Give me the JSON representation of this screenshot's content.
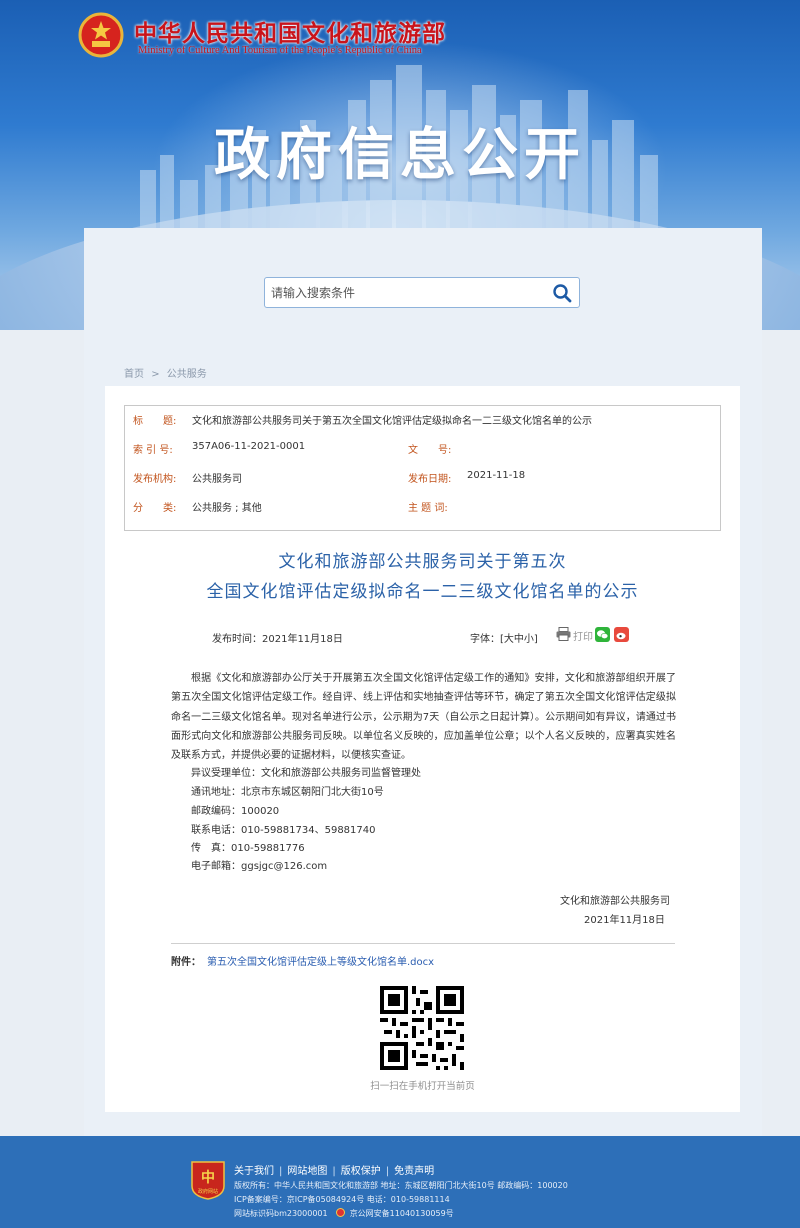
{
  "header": {
    "logo_cn": "中华人民共和国文化和旅游部",
    "logo_en": "Ministry of Culture And Tourism of the People’s Republic of China",
    "banner_title": "政府信息公开"
  },
  "search": {
    "placeholder": "请输入搜索条件"
  },
  "breadcrumb": {
    "home": "首页",
    "separator": ">",
    "section": "公共服务"
  },
  "meta": {
    "title_label": "标　　题:",
    "title_value": "文化和旅游部公共服务司关于第五次全国文化馆评估定级拟命名一二三级文化馆名单的公示",
    "index_label": "索 引 号:",
    "index_value": "357A06-11-2021-0001",
    "docno_label": "文　　号:",
    "docno_value": "",
    "publisher_label": "发布机构:",
    "publisher_value": "公共服务司",
    "date_label": "发布日期:",
    "date_value": "2021-11-18",
    "category_label": "分　　类:",
    "category_value": "公共服务 ;  其他",
    "subject_label": "主 题 词:",
    "subject_value": ""
  },
  "document": {
    "title_line1": "文化和旅游部公共服务司关于第五次",
    "title_line2": "全国文化馆评估定级拟命名一二三级文化馆名单的公示",
    "publish_time": "发布时间：2021年11月18日",
    "font_size_label": "字体：[大中小]",
    "print_label": "打印",
    "paragraph": "根据《文化和旅游部办公厅关于开展第五次全国文化馆评估定级工作的通知》安排，文化和旅游部组织开展了第五次全国文化馆评估定级工作。经自评、线上评估和实地抽查评估等环节，确定了第五次全国文化馆评估定级拟命名一二三级文化馆名单。现对名单进行公示，公示期为7天（自公示之日起计算）。公示期间如有异议，请通过书面形式向文化和旅游部公共服务司反映。以单位名义反映的，应加盖单位公章；以个人名义反映的，应署真实姓名及联系方式，并提供必要的证据材料，以便核实查证。",
    "contacts": [
      "异议受理单位：文化和旅游部公共服务司监督管理处",
      "通讯地址：北京市东城区朝阳门北大街10号",
      "邮政编码：100020",
      "联系电话：010-59881734、59881740",
      "传　真：010-59881776",
      "电子邮箱：ggsjgc@126.com"
    ],
    "signature_org": "文化和旅游部公共服务司",
    "signature_date": "2021年11月18日",
    "attachment_label": "附件：",
    "attachment_link": "第五次全国文化馆评估定级上等级文化馆名单.docx",
    "qr_caption": "扫一扫在手机打开当前页"
  },
  "footer": {
    "links": [
      "关于我们",
      "网站地图",
      "版权保护",
      "免责声明"
    ],
    "copyright": "版权所有：中华人民共和国文化和旅游部  地址：东城区朝阳门北大街10号  邮政编码：100020",
    "icp": "ICP备案编号：京ICP备05084924号   电话：010-59881114",
    "site_id": "网站标识码bm23000001",
    "police": "京公网安备11040130059号",
    "badge_text": "政府网站"
  },
  "colors": {
    "label_orange": "#c2541d",
    "title_blue": "#2b62a8",
    "link_blue": "#2a5db0",
    "footer_blue": "#2d6fb8",
    "logo_red": "#c9141b"
  }
}
